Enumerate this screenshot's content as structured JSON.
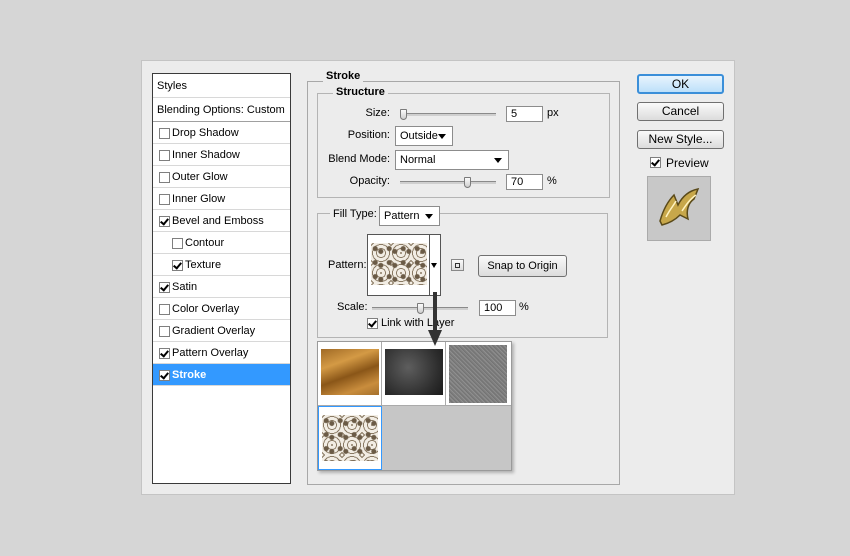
{
  "styles_panel": {
    "title": "Styles",
    "blending_options": "Blending Options: Custom",
    "items": [
      {
        "label": "Drop Shadow",
        "checked": false,
        "indent": false
      },
      {
        "label": "Inner Shadow",
        "checked": false,
        "indent": false
      },
      {
        "label": "Outer Glow",
        "checked": false,
        "indent": false
      },
      {
        "label": "Inner Glow",
        "checked": false,
        "indent": false
      },
      {
        "label": "Bevel and Emboss",
        "checked": true,
        "indent": false
      },
      {
        "label": "Contour",
        "checked": false,
        "indent": true
      },
      {
        "label": "Texture",
        "checked": true,
        "indent": true
      },
      {
        "label": "Satin",
        "checked": true,
        "indent": false
      },
      {
        "label": "Color Overlay",
        "checked": false,
        "indent": false
      },
      {
        "label": "Gradient Overlay",
        "checked": false,
        "indent": false
      },
      {
        "label": "Pattern Overlay",
        "checked": true,
        "indent": false
      },
      {
        "label": "Stroke",
        "checked": true,
        "indent": false,
        "selected": true
      }
    ]
  },
  "stroke": {
    "title": "Stroke",
    "structure": {
      "title": "Structure",
      "size_label": "Size:",
      "size_value": "5",
      "size_unit": "px",
      "position_label": "Position:",
      "position_value": "Outside",
      "blend_mode_label": "Blend Mode:",
      "blend_mode_value": "Normal",
      "opacity_label": "Opacity:",
      "opacity_value": "70",
      "opacity_unit": "%"
    },
    "fill_type_label": "Fill Type:",
    "fill_type_value": "Pattern",
    "pattern_label": "Pattern:",
    "snap_to_origin": "Snap to Origin",
    "scale_label": "Scale:",
    "scale_value": "100",
    "scale_unit": "%",
    "link_with_layer": "Link with Layer",
    "link_checked": true
  },
  "pattern_picker": {
    "swatches": [
      "wood-grain-pattern",
      "dark-grunge-pattern",
      "gray-noise-pattern",
      "ornament-pattern"
    ],
    "selected_index": 3
  },
  "buttons": {
    "ok": "OK",
    "cancel": "Cancel",
    "new_style": "New Style...",
    "preview": "Preview",
    "preview_checked": true
  },
  "colors": {
    "selection": "#3399ff",
    "dialog_bg": "#ececec",
    "ok_border": "#3b8fd9"
  }
}
